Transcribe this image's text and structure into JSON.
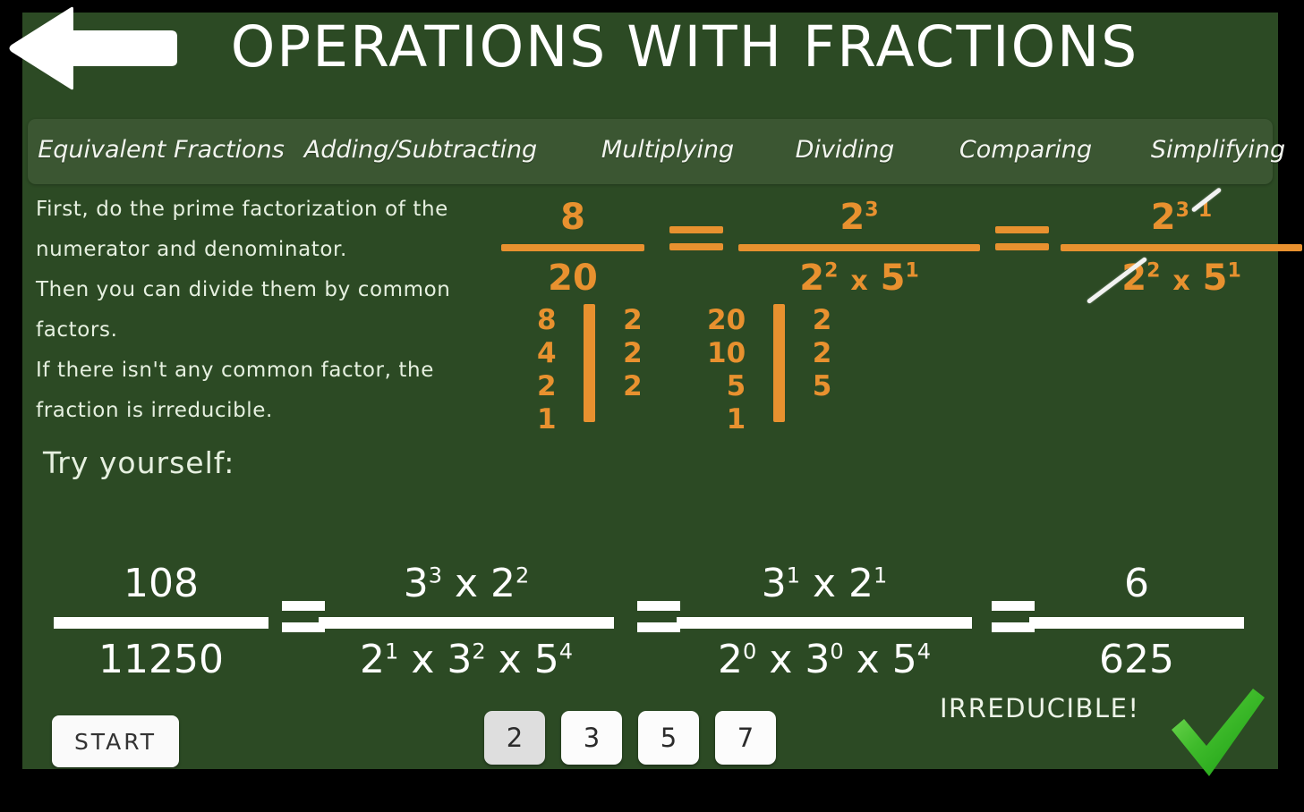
{
  "header": {
    "title": "OPERATIONS WITH FRACTIONS",
    "back_icon": "back-arrow-icon"
  },
  "tabs": [
    {
      "id": "equivalent",
      "label": "Equivalent Fractions"
    },
    {
      "id": "adding",
      "label": "Adding/Subtracting"
    },
    {
      "id": "multiplying",
      "label": "Multiplying"
    },
    {
      "id": "dividing",
      "label": "Dividing"
    },
    {
      "id": "comparing",
      "label": "Comparing"
    },
    {
      "id": "simplifying",
      "label": "Simplifying"
    }
  ],
  "active_tab": "simplifying",
  "lesson": {
    "line1": "First, do the prime factorization of the",
    "line2": "numerator and denominator.",
    "line3": "Then you can divide them by common",
    "line4": "factors.",
    "line5": "If there isn't any common factor, the",
    "line6": "fraction is irreducible."
  },
  "example": {
    "step1": {
      "numerator": "8",
      "denominator": "20"
    },
    "equals1": "=",
    "step2": {
      "numerator_base": "2",
      "numerator_exp": "3",
      "den_base1": "2",
      "den_exp1": "2",
      "den_times": "x",
      "den_base2": "5",
      "den_exp2": "1"
    },
    "equals2": "=",
    "step3": {
      "numerator_base": "2",
      "numerator_exp_struck": "3",
      "numerator_exp_new": "1",
      "den_base1": "2",
      "den_exp1": "2",
      "den_times": "x",
      "den_base2": "5",
      "den_exp2": "1"
    }
  },
  "ladders": [
    {
      "id": "ladder-8",
      "left": [
        "8",
        "4",
        "2",
        "1"
      ],
      "right": [
        "2",
        "2",
        "2"
      ]
    },
    {
      "id": "ladder-20",
      "left": [
        "20",
        "10",
        "5",
        "1"
      ],
      "right": [
        "2",
        "2",
        "5"
      ]
    }
  ],
  "practice": {
    "prompt": "Try yourself:",
    "step1": {
      "numerator": "108",
      "denominator": "11250"
    },
    "equals1": "=",
    "step2": {
      "num_base1": "3",
      "num_exp1": "3",
      "num_times": "x",
      "num_base2": "2",
      "num_exp2": "2",
      "den_base1": "2",
      "den_exp1": "1",
      "den_times1": "x",
      "den_base2": "3",
      "den_exp2": "2",
      "den_times2": "x",
      "den_base3": "5",
      "den_exp3": "4"
    },
    "equals2": "=",
    "step3": {
      "num_base1": "3",
      "num_exp1": "1",
      "num_times": "x",
      "num_base2": "2",
      "num_exp2": "1",
      "den_base1": "2",
      "den_exp1": "0",
      "den_times1": "x",
      "den_base2": "3",
      "den_exp2": "0",
      "den_times2": "x",
      "den_base3": "5",
      "den_exp3": "4"
    },
    "equals3": "=",
    "step4": {
      "numerator": "6",
      "denominator": "625"
    }
  },
  "controls": {
    "start_label": "START",
    "number_buttons": [
      {
        "label": "2",
        "pressed": true
      },
      {
        "label": "3",
        "pressed": false
      },
      {
        "label": "5",
        "pressed": false
      },
      {
        "label": "7",
        "pressed": false
      }
    ],
    "status_text": "IRREDUCIBLE!",
    "status_icon": "green-checkmark-icon"
  },
  "colors": {
    "board_green": "#2c4a24",
    "tabbar_green": "#3b5632",
    "chalk_white": "#ffffff",
    "orange": "#e8912f",
    "check_green": "#3fbb2b",
    "frame_black": "#000000"
  }
}
